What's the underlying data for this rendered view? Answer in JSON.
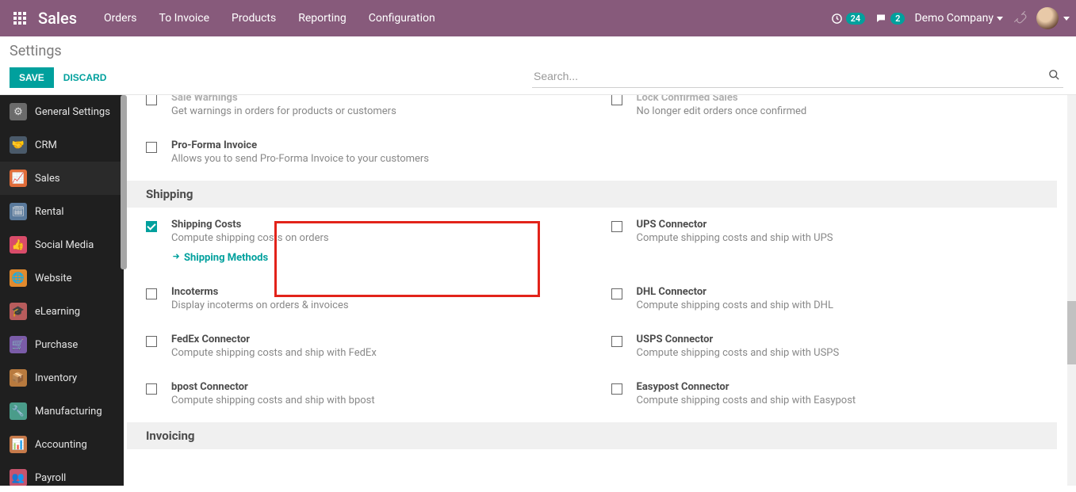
{
  "topnav": {
    "brand": "Sales",
    "menu": [
      "Orders",
      "To Invoice",
      "Products",
      "Reporting",
      "Configuration"
    ],
    "activities_count": "24",
    "messages_count": "2",
    "company": "Demo Company"
  },
  "cp": {
    "breadcrumb": "Settings",
    "save": "SAVE",
    "discard": "DISCARD",
    "search_placeholder": "Search..."
  },
  "sidebar": {
    "items": [
      {
        "label": "General Settings",
        "icon_bg": "#6b6b6b",
        "glyph": "⚙"
      },
      {
        "label": "CRM",
        "icon_bg": "#4a5a6a",
        "glyph": "🤝"
      },
      {
        "label": "Sales",
        "icon_bg": "#e06c39",
        "glyph": "📈",
        "active": true
      },
      {
        "label": "Rental",
        "icon_bg": "#5a7a9c",
        "glyph": "🗓"
      },
      {
        "label": "Social Media",
        "icon_bg": "#d94c6a",
        "glyph": "👍"
      },
      {
        "label": "Website",
        "icon_bg": "#e08a2e",
        "glyph": "🌐"
      },
      {
        "label": "eLearning",
        "icon_bg": "#b85c5c",
        "glyph": "🎓"
      },
      {
        "label": "Purchase",
        "icon_bg": "#7a5ca8",
        "glyph": "🛒"
      },
      {
        "label": "Inventory",
        "icon_bg": "#b87a3e",
        "glyph": "📦"
      },
      {
        "label": "Manufacturing",
        "icon_bg": "#4a9c8a",
        "glyph": "🔧"
      },
      {
        "label": "Accounting",
        "icon_bg": "#c77a4a",
        "glyph": "📊"
      },
      {
        "label": "Payroll",
        "icon_bg": "#c7546e",
        "glyph": "👥"
      }
    ]
  },
  "settings": {
    "top_partial": {
      "left": {
        "title": "Sale Warnings",
        "desc": "Get warnings in orders for products or customers"
      },
      "right": {
        "title": "Lock Confirmed Sales",
        "desc": "No longer edit orders once confirmed"
      }
    },
    "proforma": {
      "title": "Pro-Forma Invoice",
      "desc": "Allows you to send Pro-Forma Invoice to your customers"
    },
    "section_shipping": "Shipping",
    "shipping_costs": {
      "title": "Shipping Costs",
      "desc": "Compute shipping costs on orders",
      "link": "Shipping Methods",
      "checked": true
    },
    "ups": {
      "title": "UPS Connector",
      "desc": "Compute shipping costs and ship with UPS"
    },
    "incoterms": {
      "title": "Incoterms",
      "desc": "Display incoterms on orders & invoices"
    },
    "dhl": {
      "title": "DHL Connector",
      "desc": "Compute shipping costs and ship with DHL"
    },
    "fedex": {
      "title": "FedEx Connector",
      "desc": "Compute shipping costs and ship with FedEx"
    },
    "usps": {
      "title": "USPS Connector",
      "desc": "Compute shipping costs and ship with USPS"
    },
    "bpost": {
      "title": "bpost Connector",
      "desc": "Compute shipping costs and ship with bpost"
    },
    "easypost": {
      "title": "Easypost Connector",
      "desc": "Compute shipping costs and ship with Easypost"
    },
    "section_invoicing": "Invoicing"
  }
}
